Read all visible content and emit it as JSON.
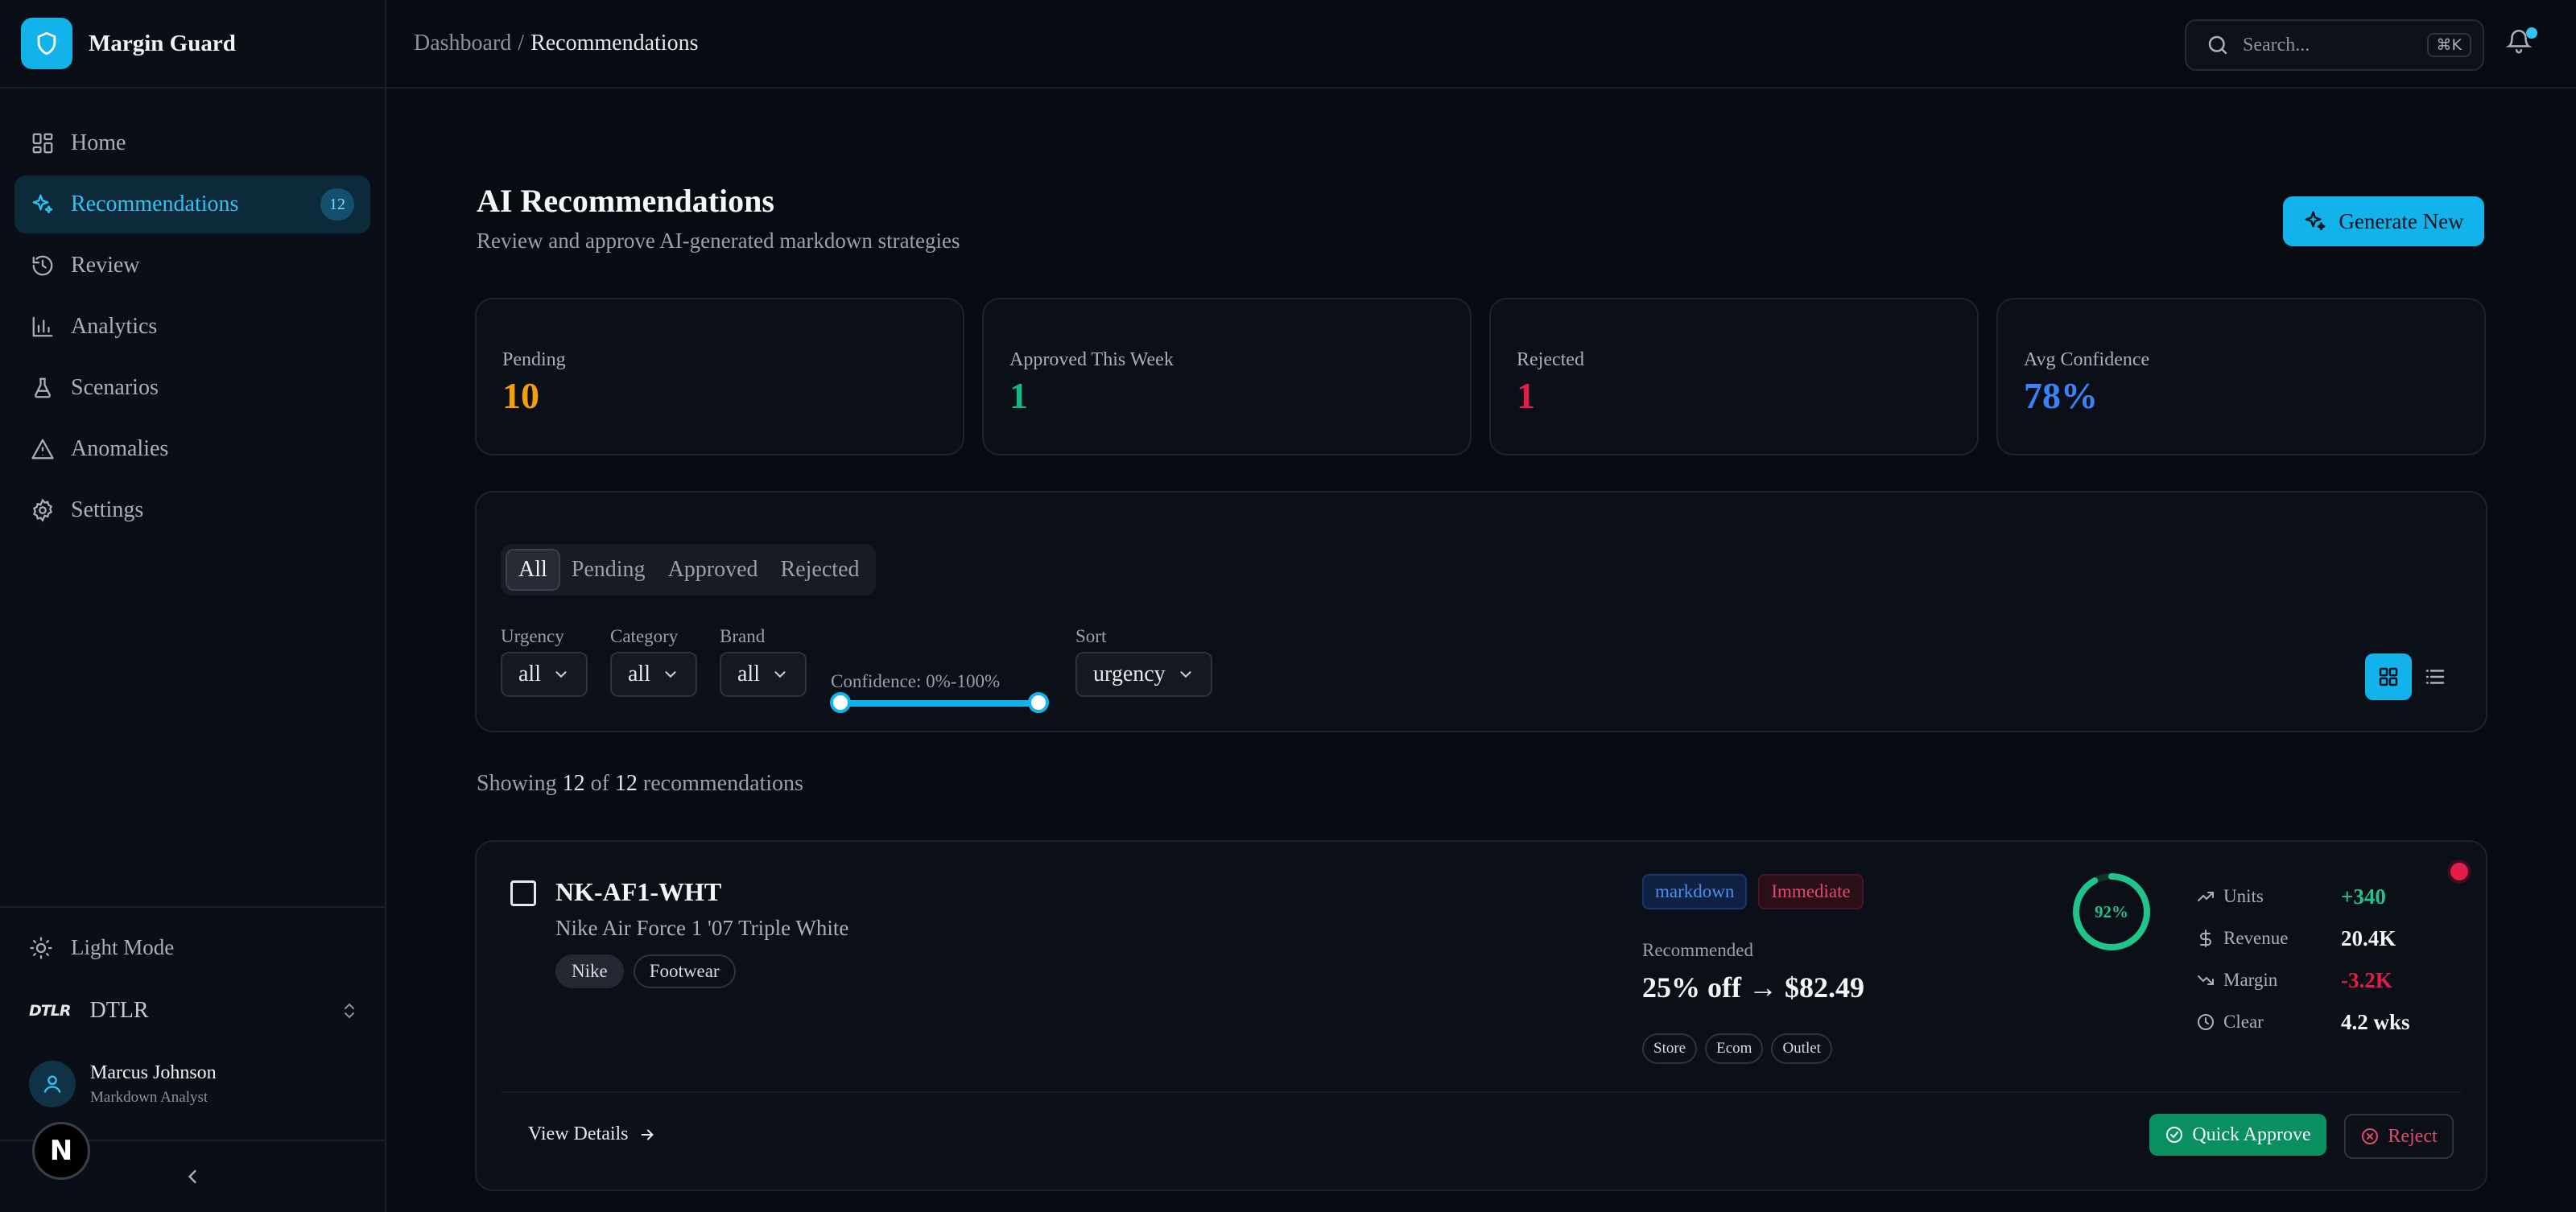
{
  "app": {
    "name": "Margin Guard"
  },
  "colors": {
    "accent": "#12b3ea",
    "pending": "#f59e0b",
    "approved": "#10b981",
    "rejected": "#e11d48",
    "confidence": "#3b82f6"
  },
  "sidebar": {
    "items": [
      {
        "label": "Home",
        "icon": "home-grid-icon"
      },
      {
        "label": "Recommendations",
        "icon": "sparkles-icon",
        "badge": "12",
        "active": true
      },
      {
        "label": "Review",
        "icon": "history-icon"
      },
      {
        "label": "Analytics",
        "icon": "bar-chart-icon"
      },
      {
        "label": "Scenarios",
        "icon": "flask-icon"
      },
      {
        "label": "Anomalies",
        "icon": "warning-triangle-icon"
      },
      {
        "label": "Settings",
        "icon": "gear-icon"
      }
    ],
    "light_mode": "Light Mode",
    "org_logo": "DTLR",
    "org_name": "DTLR",
    "user": {
      "name": "Marcus Johnson",
      "role": "Markdown Analyst"
    },
    "n_badge": "N"
  },
  "header": {
    "breadcrumb_root": "Dashboard",
    "breadcrumb_sep": "/",
    "breadcrumb_current": "Recommendations",
    "search_placeholder": "Search...",
    "search_shortcut": "⌘K"
  },
  "page": {
    "title": "AI Recommendations",
    "subtitle": "Review and approve AI-generated markdown strategies",
    "generate_label": "Generate New"
  },
  "stats": [
    {
      "label": "Pending",
      "value": "10"
    },
    {
      "label": "Approved This Week",
      "value": "1"
    },
    {
      "label": "Rejected",
      "value": "1"
    },
    {
      "label": "Avg Confidence",
      "value": "78%"
    }
  ],
  "filters": {
    "tabs": [
      "All",
      "Pending",
      "Approved",
      "Rejected"
    ],
    "active_tab": "All",
    "urgency": {
      "label": "Urgency",
      "value": "all"
    },
    "category": {
      "label": "Category",
      "value": "all"
    },
    "brand": {
      "label": "Brand",
      "value": "all"
    },
    "confidence": {
      "label": "Confidence: 0%-100%",
      "min": 0,
      "max": 100
    },
    "sort": {
      "label": "Sort",
      "value": "urgency"
    }
  },
  "showing": {
    "prefix": "Showing",
    "count": "12",
    "of": "of",
    "total": "12",
    "suffix": "recommendations"
  },
  "card": {
    "sku": "NK-AF1-WHT",
    "product_name": "Nike Air Force 1 '07 Triple White",
    "tags": [
      "Nike",
      "Footwear"
    ],
    "type_badge": "markdown",
    "urgency_badge": "Immediate",
    "recommended_label": "Recommended",
    "recommended_value": "25% off → $82.49",
    "channels": [
      "Store",
      "Ecom",
      "Outlet"
    ],
    "confidence": "92%",
    "confidence_value": 0.92,
    "metrics": [
      {
        "label": "Units",
        "value": "+340",
        "color": "#20c48a"
      },
      {
        "label": "Revenue",
        "value": "20.4K",
        "color": "#f4f6fa"
      },
      {
        "label": "Margin",
        "value": "-3.2K",
        "color": "#e11d48"
      },
      {
        "label": "Clear",
        "value": "4.2 wks",
        "color": "#f4f6fa"
      }
    ],
    "view_details": "View Details",
    "quick_approve": "Quick Approve",
    "reject": "Reject"
  }
}
